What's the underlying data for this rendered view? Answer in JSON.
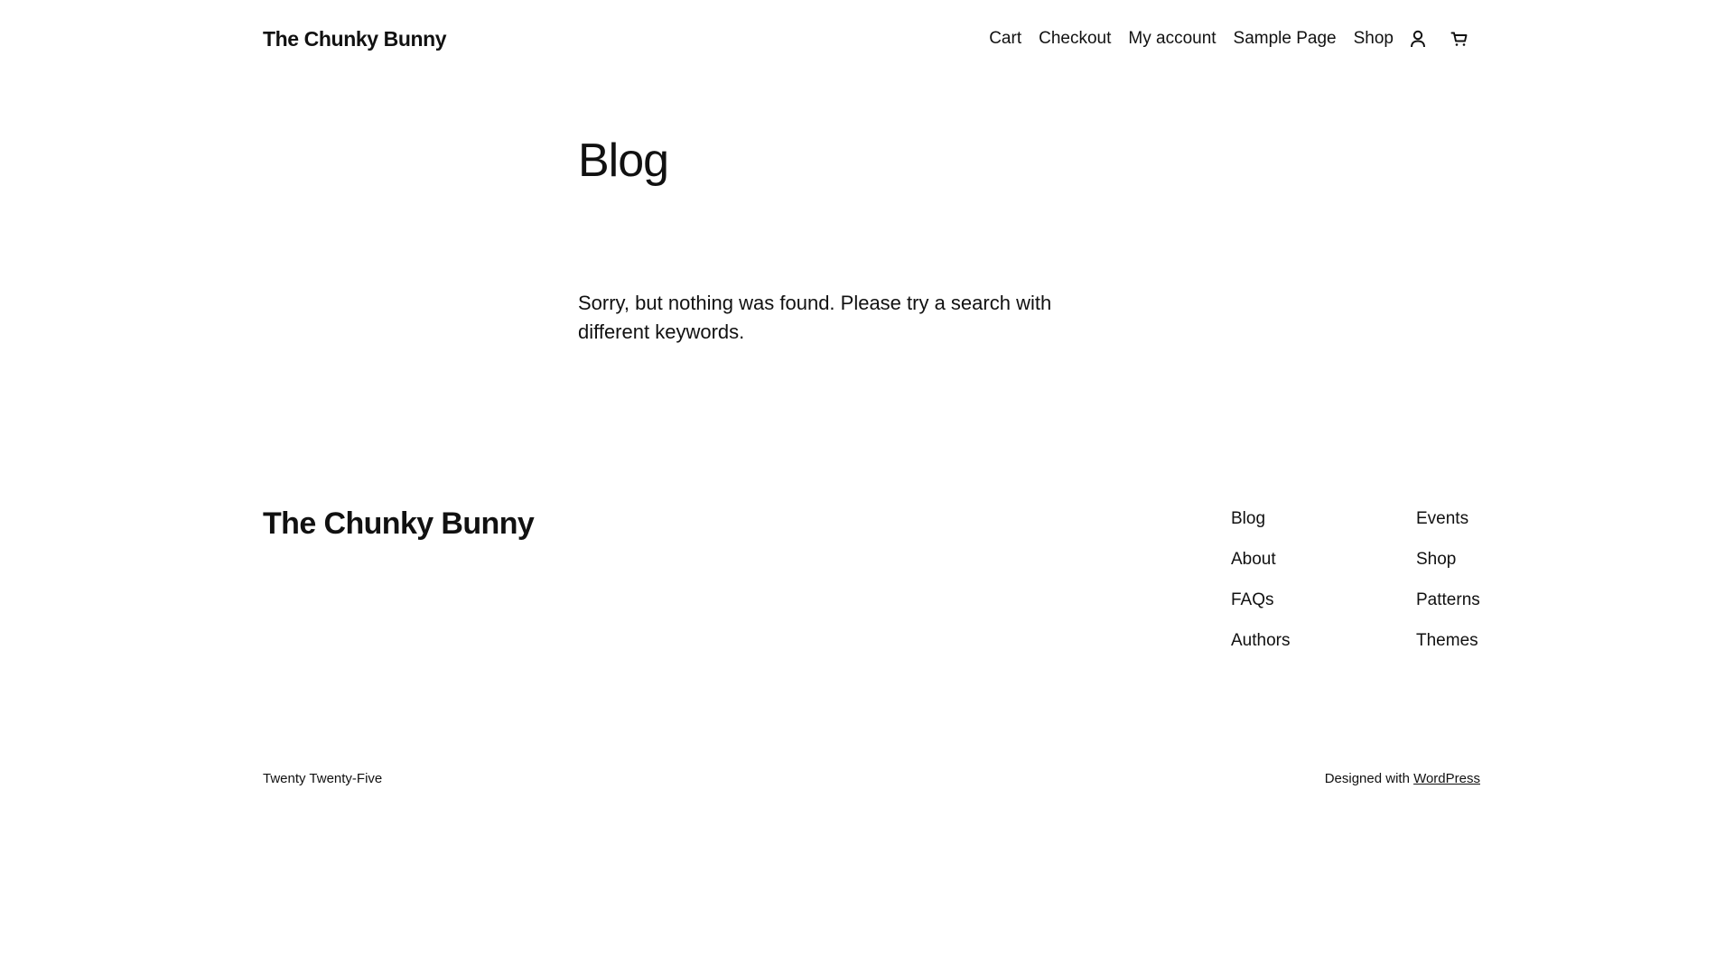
{
  "header": {
    "site_title": "The Chunky Bunny",
    "nav": [
      {
        "label": "Cart"
      },
      {
        "label": "Checkout"
      },
      {
        "label": "My account"
      },
      {
        "label": "Sample Page"
      },
      {
        "label": "Shop"
      }
    ],
    "icons": {
      "account": "user-icon",
      "cart": "cart-icon"
    }
  },
  "main": {
    "title": "Blog",
    "message": "Sorry, but nothing was found. Please try a search with different keywords."
  },
  "footer": {
    "site_title": "The Chunky Bunny",
    "col1": [
      {
        "label": "Blog"
      },
      {
        "label": "About"
      },
      {
        "label": "FAQs"
      },
      {
        "label": "Authors"
      }
    ],
    "col2": [
      {
        "label": "Events"
      },
      {
        "label": "Shop"
      },
      {
        "label": "Patterns"
      },
      {
        "label": "Themes"
      }
    ],
    "theme_name": "Twenty Twenty-Five",
    "credit_prefix": "Designed with",
    "credit_link": "WordPress"
  },
  "colors": {
    "text": "#111111",
    "background": "#ffffff"
  }
}
